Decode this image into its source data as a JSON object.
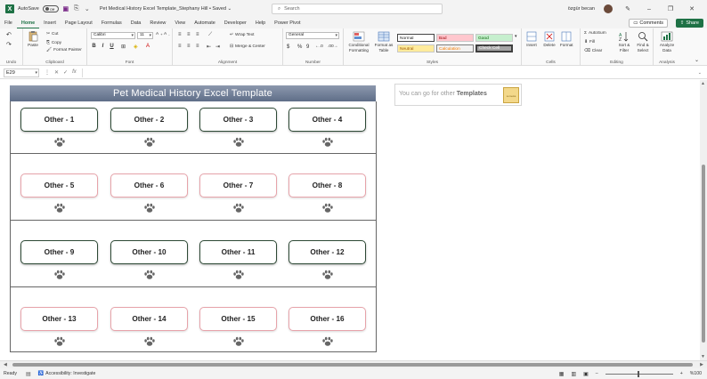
{
  "window": {
    "autosave_label": "AutoSave",
    "autosave_state": "Off",
    "doc_title": "Pet Medical History Excel Template_Stephany Hill • Saved ⌄",
    "search_placeholder": "Search",
    "user_name": "özgür becan"
  },
  "tabs": [
    "File",
    "Home",
    "Insert",
    "Page Layout",
    "Formulas",
    "Data",
    "Review",
    "View",
    "Automate",
    "Developer",
    "Help",
    "Power Pivot"
  ],
  "active_tab": "Home",
  "actions": {
    "comments": "Comments",
    "share": "Share"
  },
  "ribbon": {
    "undo_group": "Undo",
    "clipboard": {
      "label": "Clipboard",
      "paste": "Paste",
      "cut": "Cut",
      "copy": "Copy",
      "format_painter": "Format Painter"
    },
    "font": {
      "label": "Font",
      "name": "Calibri",
      "size": "11",
      "bold": "B",
      "italic": "I",
      "underline": "U"
    },
    "alignment": {
      "label": "Alignment",
      "wrap": "Wrap Text",
      "merge": "Merge & Center"
    },
    "number": {
      "label": "Number",
      "format": "General",
      "currency": "$",
      "percent": "%",
      "comma": "9",
      "inc": "←.0",
      "dec": ".00→"
    },
    "styles": {
      "label": "Styles",
      "conditional": "Conditional Formatting",
      "format_table": "Format as Table",
      "cells": [
        "Normal",
        "Bad",
        "Good",
        "Neutral",
        "Calculation",
        "Check Cell"
      ]
    },
    "cells": {
      "label": "Cells",
      "insert": "Insert",
      "delete": "Delete",
      "format": "Format"
    },
    "editing": {
      "label": "Editing",
      "autosum": "AutoSum",
      "fill": "Fill",
      "clear": "Clear",
      "sort": "Sort & Filter",
      "find": "Find & Select"
    },
    "analysis": {
      "label": "Analysis",
      "analyze": "Analyze Data"
    }
  },
  "formula_bar": {
    "name_box": "E29",
    "fx": "fx",
    "value": ""
  },
  "sheet": {
    "banner_title": "Pet Medical History Excel Template",
    "promo_text": "You can go for other ",
    "promo_bold": "Templates",
    "promo_logo": "someka",
    "rows": [
      [
        "Other - 1",
        "Other - 2",
        "Other - 3",
        "Other - 4"
      ],
      [
        "Other - 5",
        "Other - 6",
        "Other - 7",
        "Other - 8"
      ],
      [
        "Other - 9",
        "Other - 10",
        "Other - 11",
        "Other - 12"
      ],
      [
        "Other - 13",
        "Other - 14",
        "Other - 15",
        "Other - 16"
      ]
    ]
  },
  "status": {
    "ready": "Ready",
    "accessibility": "Accessibility: Investigate",
    "zoom": "%100"
  },
  "colors": {
    "excel_green": "#1e7145",
    "banner_blue": "#6f7d95",
    "box_green_border": "#2e4a36",
    "box_pink_border": "#e7a3aa"
  }
}
